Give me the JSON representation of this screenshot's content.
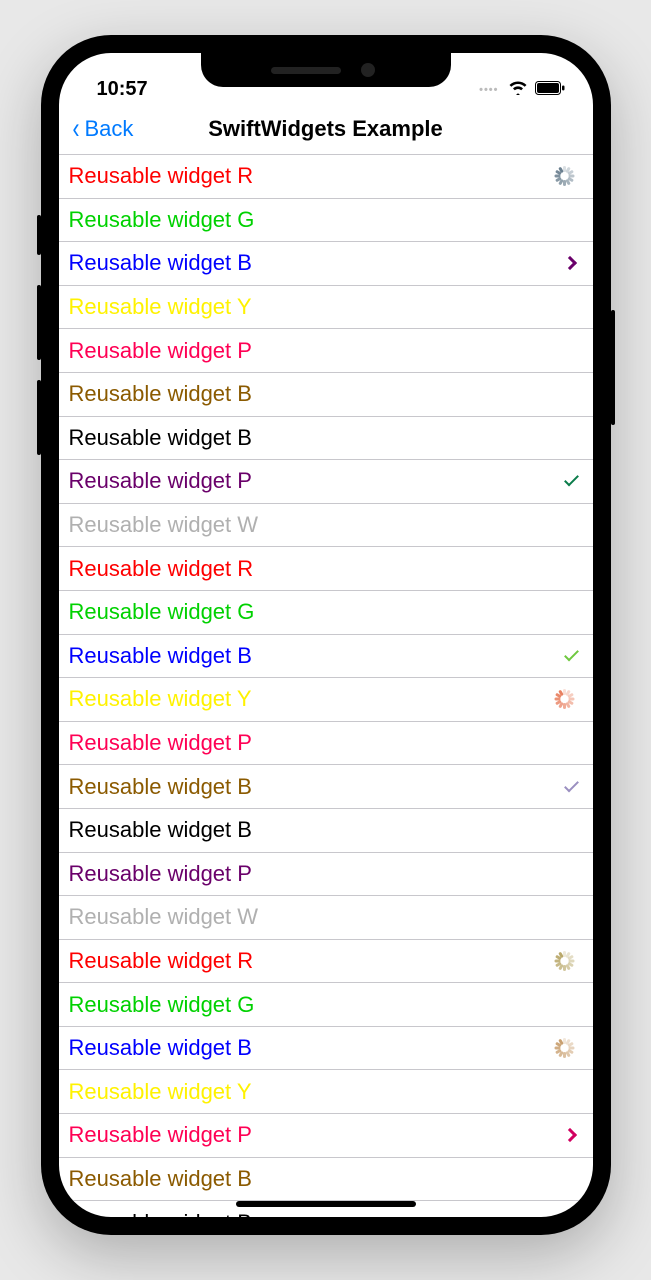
{
  "status": {
    "time": "10:57"
  },
  "nav": {
    "back_label": "Back",
    "title": "SwiftWidgets Example"
  },
  "colors": {
    "red": "#fe0000",
    "green": "#00d100",
    "blue": "#0000fe",
    "yellow": "#fff200",
    "pink": "#ff0054",
    "brown": "#8b5a00",
    "black": "#000000",
    "purple": "#6a006a",
    "grey": "#b0b0b0",
    "darkgreen": "#0a7c4a",
    "lightgreen": "#6fc83f",
    "lavender": "#9a8fc0",
    "magenta": "#d10060",
    "spinner_blue": "#6a7f8f",
    "spinner_orange": "#e88060",
    "spinner_olive": "#b9a86a",
    "spinner_tan": "#c9a070",
    "spinner_pink": "#e69ac7"
  },
  "rows": [
    {
      "label": "Reusable widget R",
      "color": "red",
      "accessory": "spinner",
      "acc_color": "spinner_blue"
    },
    {
      "label": "Reusable widget G",
      "color": "green",
      "accessory": null
    },
    {
      "label": "Reusable widget B",
      "color": "blue",
      "accessory": "chevron",
      "acc_color": "purple"
    },
    {
      "label": "Reusable widget Y",
      "color": "yellow",
      "accessory": null
    },
    {
      "label": "Reusable widget P",
      "color": "pink",
      "accessory": null
    },
    {
      "label": "Reusable widget B",
      "color": "brown",
      "accessory": null
    },
    {
      "label": "Reusable widget B",
      "color": "black",
      "accessory": null
    },
    {
      "label": "Reusable widget P",
      "color": "purple",
      "accessory": "check",
      "acc_color": "darkgreen"
    },
    {
      "label": "Reusable widget W",
      "color": "grey",
      "accessory": null
    },
    {
      "label": "Reusable widget R",
      "color": "red",
      "accessory": null
    },
    {
      "label": "Reusable widget G",
      "color": "green",
      "accessory": null
    },
    {
      "label": "Reusable widget B",
      "color": "blue",
      "accessory": "check",
      "acc_color": "lightgreen"
    },
    {
      "label": "Reusable widget Y",
      "color": "yellow",
      "accessory": "spinner",
      "acc_color": "spinner_orange"
    },
    {
      "label": "Reusable widget P",
      "color": "pink",
      "accessory": null
    },
    {
      "label": "Reusable widget B",
      "color": "brown",
      "accessory": "check",
      "acc_color": "lavender"
    },
    {
      "label": "Reusable widget B",
      "color": "black",
      "accessory": null
    },
    {
      "label": "Reusable widget P",
      "color": "purple",
      "accessory": null
    },
    {
      "label": "Reusable widget W",
      "color": "grey",
      "accessory": null
    },
    {
      "label": "Reusable widget R",
      "color": "red",
      "accessory": "spinner",
      "acc_color": "spinner_olive"
    },
    {
      "label": "Reusable widget G",
      "color": "green",
      "accessory": null
    },
    {
      "label": "Reusable widget B",
      "color": "blue",
      "accessory": "spinner",
      "acc_color": "spinner_tan"
    },
    {
      "label": "Reusable widget Y",
      "color": "yellow",
      "accessory": null
    },
    {
      "label": "Reusable widget P",
      "color": "pink",
      "accessory": "chevron",
      "acc_color": "magenta"
    },
    {
      "label": "Reusable widget B",
      "color": "brown",
      "accessory": null
    },
    {
      "label": "Reusable widget B",
      "color": "black",
      "accessory": "spinner",
      "acc_color": "spinner_pink"
    }
  ]
}
